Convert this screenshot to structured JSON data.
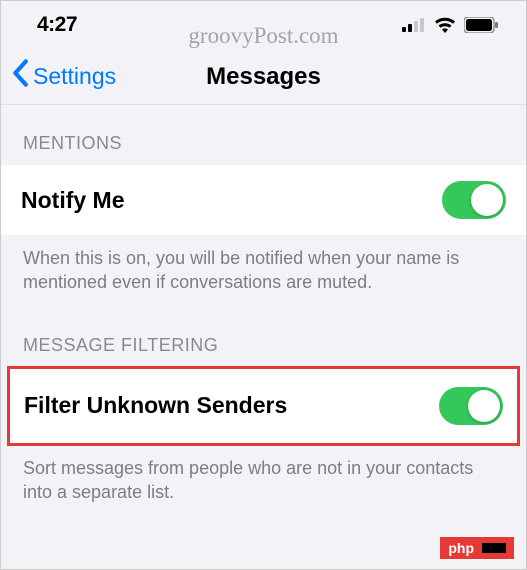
{
  "statusBar": {
    "time": "4:27"
  },
  "watermark": "groovyPost.com",
  "nav": {
    "back": "Settings",
    "title": "Messages"
  },
  "sections": {
    "mentions": {
      "header": "MENTIONS",
      "rowLabel": "Notify Me",
      "toggleOn": true,
      "footer": "When this is on, you will be notified when your name is mentioned even if conversations are muted."
    },
    "filtering": {
      "header": "MESSAGE FILTERING",
      "rowLabel": "Filter Unknown Senders",
      "toggleOn": true,
      "footer": "Sort messages from people who are not in your contacts into a separate list."
    }
  },
  "badge": "php"
}
